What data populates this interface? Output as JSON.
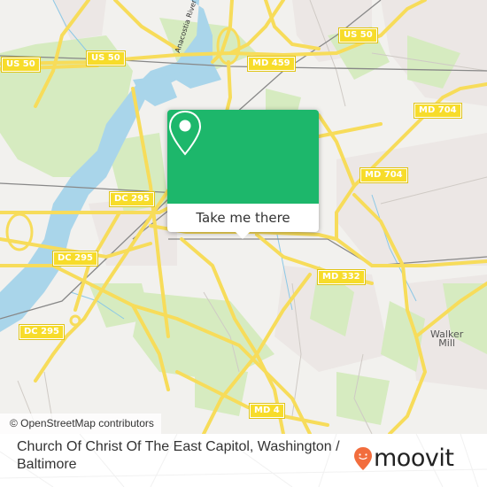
{
  "map": {
    "colors": {
      "land": "#f2f1ee",
      "park": "#d6ebc0",
      "water": "#a9d5ea",
      "road": "#f7dc5a",
      "road_label": "#f7dc2a",
      "rail": "#888888",
      "urban": "#ece7e5"
    },
    "shields": [
      {
        "id": "us50-west",
        "label": "US 50"
      },
      {
        "id": "us50-center",
        "label": "US 50"
      },
      {
        "id": "us50-east",
        "label": "US 50"
      },
      {
        "id": "md459",
        "label": "MD 459"
      },
      {
        "id": "md704-north",
        "label": "MD 704"
      },
      {
        "id": "md704-south",
        "label": "MD 704"
      },
      {
        "id": "dc295-north",
        "label": "DC 295"
      },
      {
        "id": "dc295-center",
        "label": "DC 295"
      },
      {
        "id": "dc295-south",
        "label": "DC 295"
      },
      {
        "id": "md332",
        "label": "MD 332"
      },
      {
        "id": "md4",
        "label": "MD 4"
      }
    ],
    "places": {
      "walker_mill": "Walker\nMill",
      "anacostia_river": "Anacostia River"
    },
    "attribution": "© OpenStreetMap contributors"
  },
  "popup": {
    "icon": "map-pin-icon",
    "button_label": "Take me there",
    "accent_color": "#1db76b"
  },
  "footer": {
    "title": "Church Of Christ Of The East Capitol, Washington / Baltimore",
    "brand": "moovit",
    "brand_color": "#f26d3d"
  }
}
